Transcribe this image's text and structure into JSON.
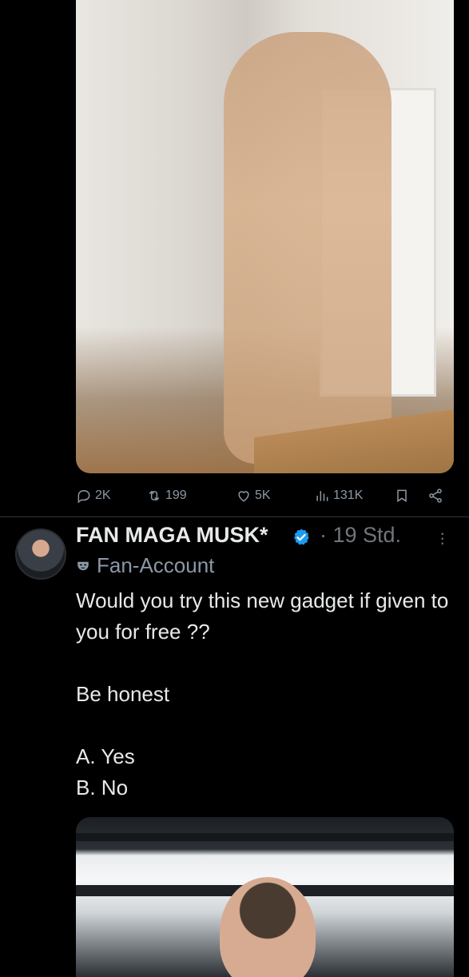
{
  "previous_post": {
    "media": {
      "type": "photo",
      "icon": "photo"
    },
    "actions": {
      "replies": "2K",
      "reposts": "199",
      "likes": "5K",
      "views": "131K"
    }
  },
  "post": {
    "author": {
      "name": "FAN MAGA MUSK*",
      "verified": true,
      "badge_color": "#1d9bf0"
    },
    "time": "· 19 Std.",
    "label": "Fan-Account",
    "text": "Would you try this new gadget if given to you for free ??\n\nBe honest\n\nA. Yes\nB. No",
    "media": {
      "type": "photo"
    }
  },
  "colors": {
    "background": "#000000",
    "text": "#e7e9ea",
    "muted": "#71767b",
    "accent": "#1d9bf0"
  }
}
